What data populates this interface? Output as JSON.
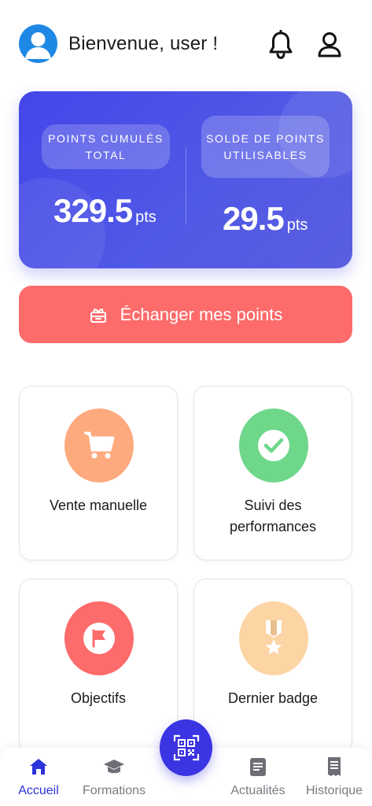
{
  "header": {
    "greeting": "Bienvenue, user !",
    "avatar_icon": "user-avatar-icon",
    "notification_icon": "bell-icon",
    "profile_icon": "user-outline-icon"
  },
  "points_card": {
    "total": {
      "label": "POINTS CUMULÉS TOTAL",
      "value": "329.5",
      "unit": "pts"
    },
    "usable": {
      "label": "SOLDE DE POINTS UTILISABLES",
      "value": "29.5",
      "unit": "pts"
    },
    "color": "#4446e8"
  },
  "exchange_button": {
    "label": "Échanger mes points",
    "icon": "gift-icon",
    "color": "#fd6b6b"
  },
  "tiles": [
    {
      "label": "Vente manuelle",
      "icon": "cart-icon",
      "color": "#fdaa7e"
    },
    {
      "label": "Suivi des performances",
      "icon": "check-circle-icon",
      "color": "#6ed78a"
    },
    {
      "label": "Objectifs",
      "icon": "flag-icon",
      "color": "#fd6b6b"
    },
    {
      "label": "Dernier badge",
      "icon": "medal-icon",
      "color": "#fdd4a4"
    }
  ],
  "bottom_nav": {
    "items": [
      {
        "label": "Accueil",
        "icon": "home-icon",
        "active": true
      },
      {
        "label": "Formations",
        "icon": "graduation-cap-icon",
        "active": false
      },
      {
        "label": "Actualités",
        "icon": "news-icon",
        "active": false
      },
      {
        "label": "Historique",
        "icon": "receipt-icon",
        "active": false
      }
    ],
    "scan_icon": "qr-code-icon",
    "active_color": "#2c33d8",
    "fab_color": "#3b34e2"
  }
}
